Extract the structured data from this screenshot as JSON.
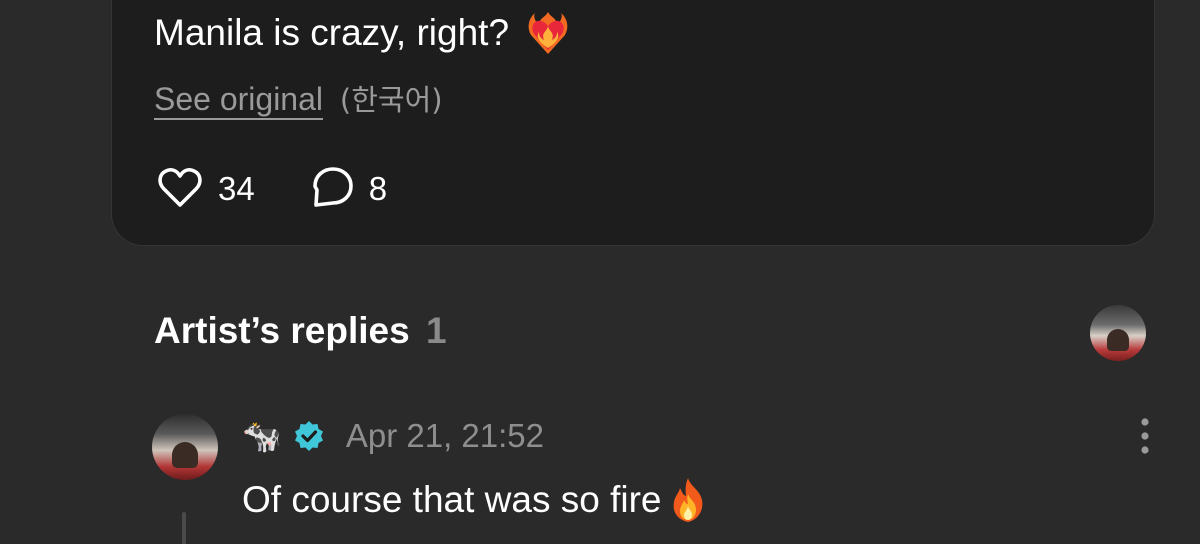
{
  "post": {
    "text": "Manila is crazy, right?",
    "emoji_icon": "heart-on-fire-icon",
    "see_original_label": "See original",
    "original_language": "(한국어)",
    "like_count": "34",
    "comment_count": "8"
  },
  "artist_replies": {
    "title": "Artist’s replies",
    "count": "1"
  },
  "reply": {
    "author_name": "🐄",
    "verified_icon": "verified-badge-icon",
    "timestamp": "Apr 21, 21:52",
    "text": "Of course that was so fire",
    "emoji_icon": "fire-icon"
  },
  "colors": {
    "background": "#2a2a2a",
    "card": "#1d1d1d",
    "muted_text": "#9a9a9a",
    "verified": "#3fc7d9"
  }
}
